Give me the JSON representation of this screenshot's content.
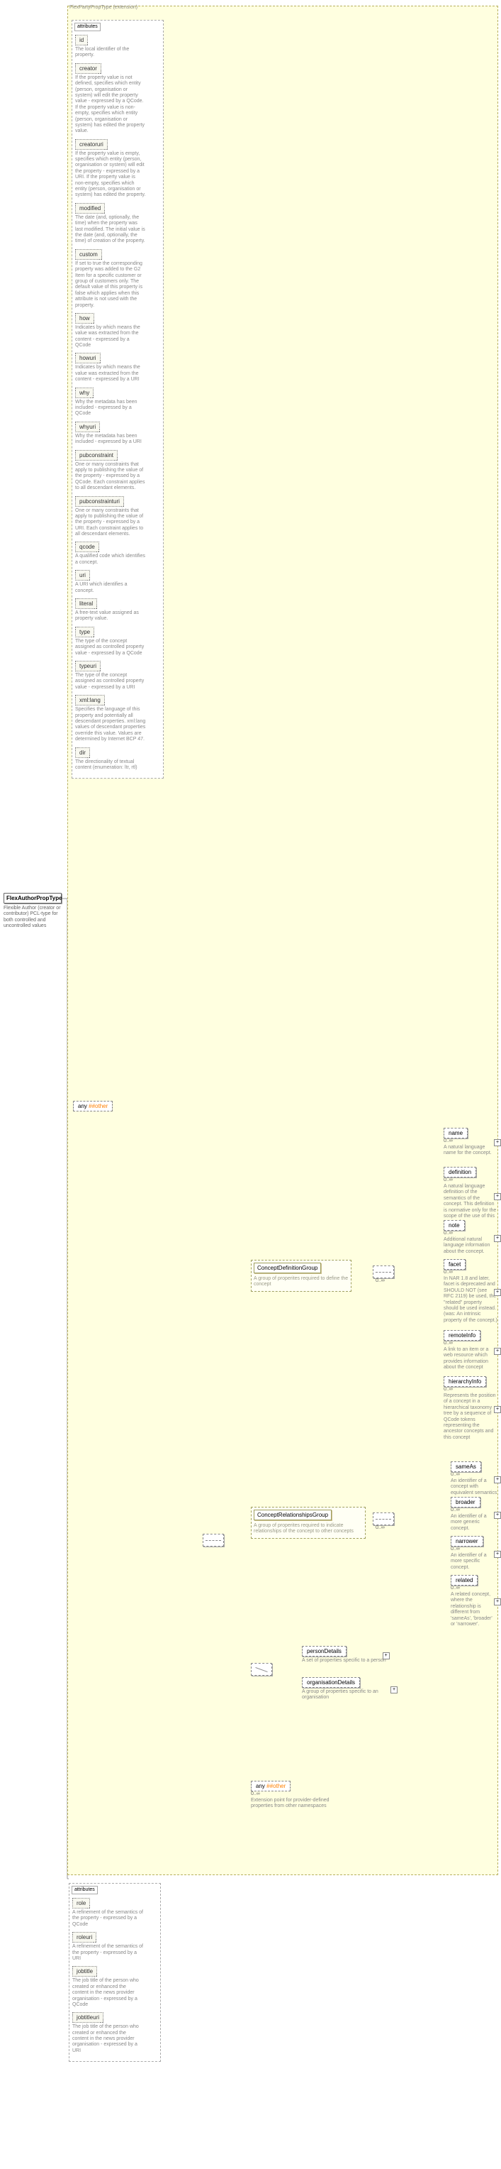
{
  "root": {
    "name": "FlexAuthorPropType",
    "desc": "Flexible Author (creator or contributor) PCL-type for both controlled and uncontrolled values"
  },
  "ext": {
    "label": "FlexPartyPropType (extension)"
  },
  "attrs_header": "attributes",
  "top_attrs": [
    {
      "name": "id",
      "desc": "The local identifier of the property."
    },
    {
      "name": "creator",
      "desc": "If the property value is not defined, specifies which entity (person, organisation or system) will edit the property value - expressed by a QCode. If the property value is non-empty, specifies which entity (person, organisation or system) has edited the property value."
    },
    {
      "name": "creatoruri",
      "desc": "If the property value is empty, specifies which entity (person, organisation or system) will edit the property - expressed by a URI. If the property value is non-empty, specifies which entity (person, organisation or system) has edited the property."
    },
    {
      "name": "modified",
      "desc": "The date (and, optionally, the time) when the property was last modified. The initial value is the date (and, optionally, the time) of creation of the property."
    },
    {
      "name": "custom",
      "desc": "If set to true the corresponding property was added to the G2 Item for a specific customer or group of customers only. The default value of this property is false which applies when this attribute is not used with the property."
    },
    {
      "name": "how",
      "desc": "Indicates by which means the value was extracted from the content - expressed by a QCode"
    },
    {
      "name": "howuri",
      "desc": "Indicates by which means the value was extracted from the content - expressed by a URI"
    },
    {
      "name": "why",
      "desc": "Why the metadata has been included - expressed by a QCode"
    },
    {
      "name": "whyuri",
      "desc": "Why the metadata has been included - expressed by a URI"
    },
    {
      "name": "pubconstraint",
      "desc": "One or many constraints that apply to publishing the value of the property - expressed by a QCode. Each constraint applies to all descendant elements."
    },
    {
      "name": "pubconstrainturi",
      "desc": "One or many constraints that apply to publishing the value of the property - expressed by a URI. Each constraint applies to all descendant elements."
    },
    {
      "name": "qcode",
      "desc": "A qualified code which identifies a concept."
    },
    {
      "name": "uri",
      "desc": "A URI which identifies a concept."
    },
    {
      "name": "literal",
      "desc": "A free-text value assigned as property value."
    },
    {
      "name": "type",
      "desc": "The type of the concept assigned as controlled property value - expressed by a QCode"
    },
    {
      "name": "typeuri",
      "desc": "The type of the concept assigned as controlled property value - expressed by a URI"
    },
    {
      "name": "xml:lang",
      "desc": "Specifies the language of this property and potentially all descendant properties. xml:lang values of descendant properties override this value. Values are determined by Internet BCP 47."
    },
    {
      "name": "dir",
      "desc": "The directionality of textual content (enumeration: ltr, rtl)"
    }
  ],
  "top_any": {
    "text": "any ",
    "hash": "##other"
  },
  "sequence_markers": {
    "zero_inf": "0..∞"
  },
  "concept_def_group": {
    "name": "ConceptDefinitionGroup",
    "desc": "A group of properites required to define the concept",
    "children": [
      {
        "name": "name",
        "card": "0..∞",
        "desc": "A natural language name for the concept."
      },
      {
        "name": "definition",
        "card": "0..∞",
        "desc": "A natural language definition of the semantics of the concept. This definition is normative only for the scope of the use of this concept."
      },
      {
        "name": "note",
        "card": "0..∞",
        "desc": "Additional natural language information about the concept."
      },
      {
        "name": "facet",
        "card": "0..∞",
        "desc": "In NAR 1.8 and later, facet is deprecated and SHOULD NOT (see RFC 2119) be used, the \"related\" property should be used instead. (was: An intrinsic property of the concept.)"
      },
      {
        "name": "remoteInfo",
        "card": "0..∞",
        "desc": "A link to an item or a web resource which provides information about the concept"
      },
      {
        "name": "hierarchyInfo",
        "card": "0..∞",
        "desc": "Represents the position of a concept in a hierarchical taxonomy tree by a sequence of QCode tokens representing the ancestor concepts and this concept"
      }
    ]
  },
  "concept_rel_group": {
    "name": "ConceptRelationshipsGroup",
    "desc": "A group of properites required to indicate relationships of the concept to other concepts",
    "children": [
      {
        "name": "sameAs",
        "card": "0..∞",
        "desc": "An identifier of a concept with equivalent semantics"
      },
      {
        "name": "broader",
        "card": "0..∞",
        "desc": "An identifier of a more generic concept."
      },
      {
        "name": "narrower",
        "card": "0..∞",
        "desc": "An identifier of a more specific concept."
      },
      {
        "name": "related",
        "card": "0..∞",
        "desc": "A related concept, where the relationship is different from 'sameAs', 'broader' or 'narrower'."
      }
    ]
  },
  "person_org": {
    "person": {
      "name": "personDetails",
      "desc": "A set of properties specific to a person"
    },
    "org": {
      "name": "organisationDetails",
      "desc": "A group of properties specific to an organisation"
    }
  },
  "low_any": {
    "text": "any ",
    "hash": "##other",
    "card": "0..∞",
    "desc": "Extension point for provider-defined properties from other namespaces"
  },
  "bottom_attrs": [
    {
      "name": "role",
      "desc": "A refinement of the semantics of the property - expressed by a QCode"
    },
    {
      "name": "roleuri",
      "desc": "A refinement of the semantics of the property - expressed by a URI"
    },
    {
      "name": "jobtitle",
      "desc": "The job title of the person who created or enhanced the content in the news provider organisation - expressed by a QCode"
    },
    {
      "name": "jobtitleuri",
      "desc": "The job title of the person who created or enhanced the content in the news provider organisation - expressed by a URI"
    }
  ]
}
